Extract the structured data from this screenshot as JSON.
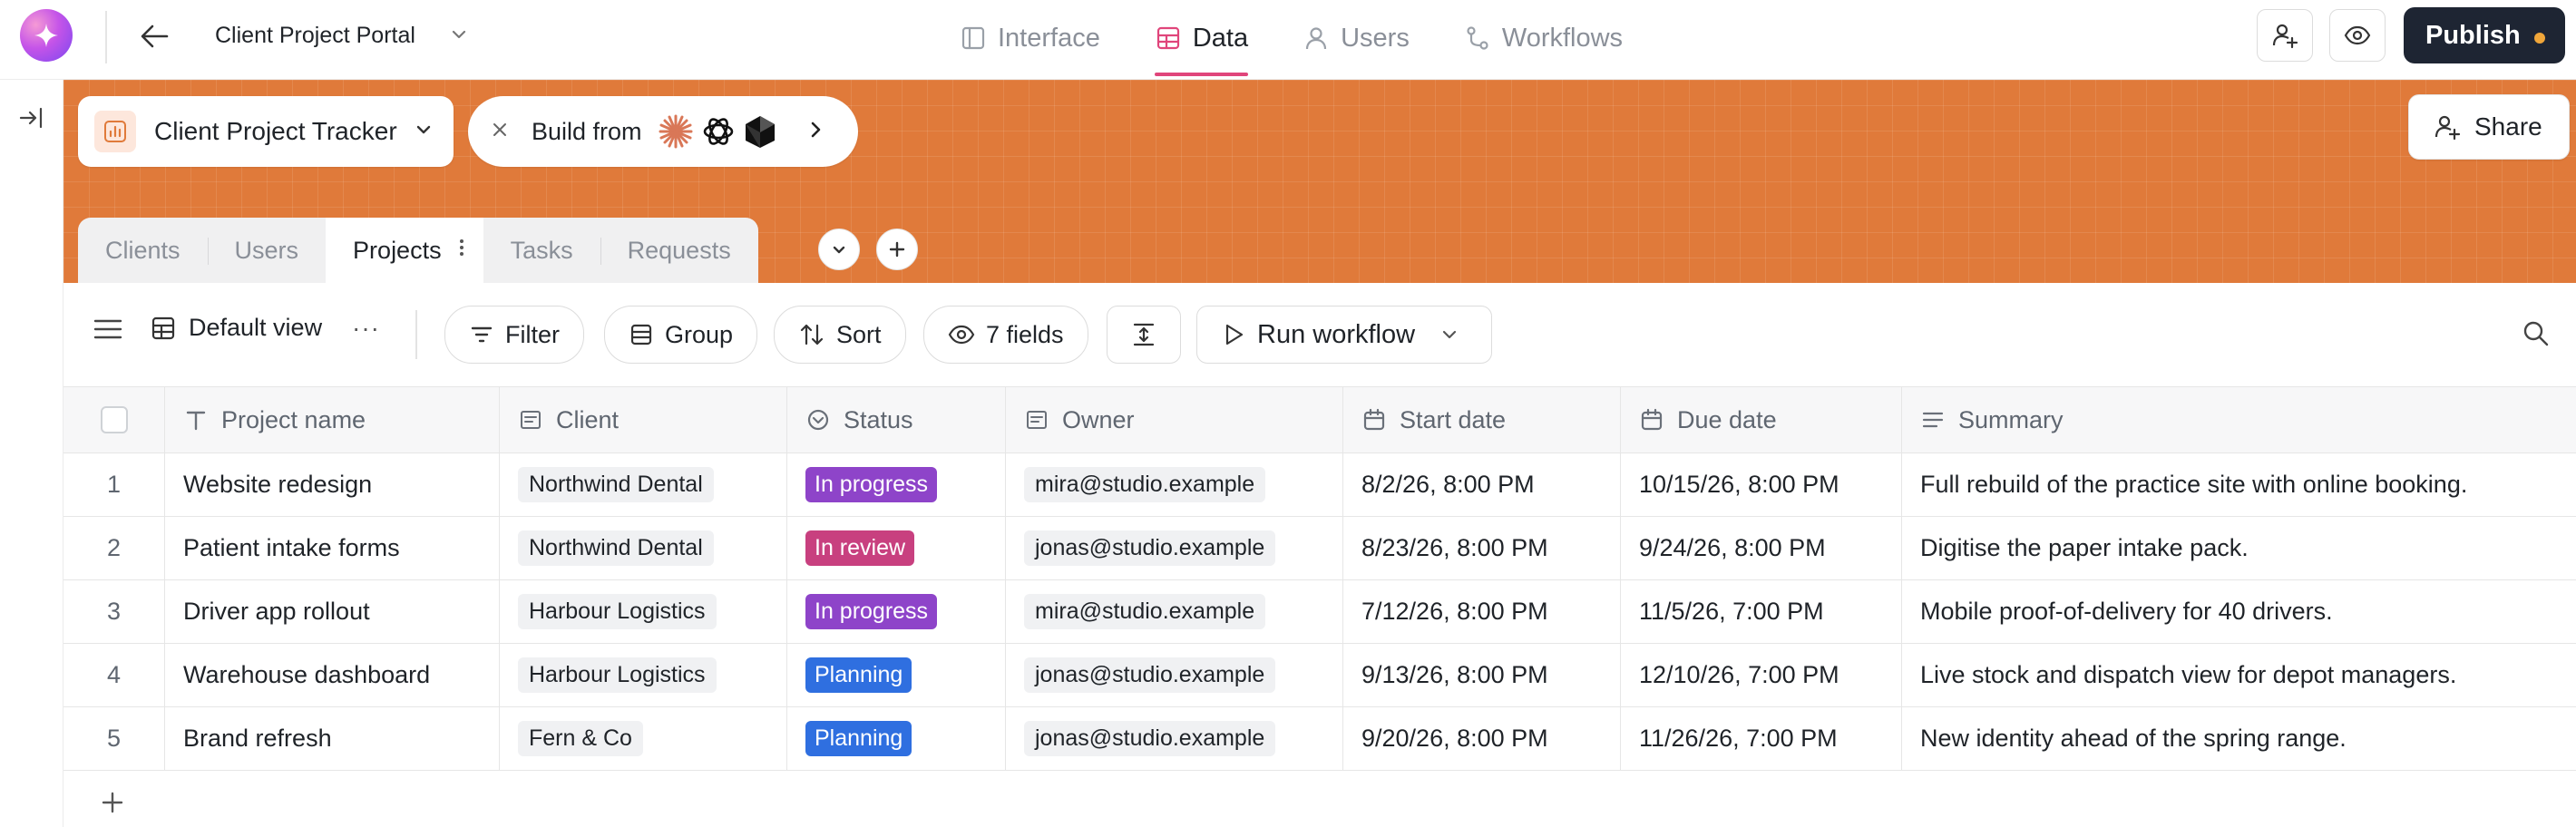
{
  "app": {
    "title": "Client Project Portal"
  },
  "nav": [
    {
      "label": "Interface",
      "icon": "layout-icon",
      "active": false
    },
    {
      "label": "Data",
      "icon": "table-icon",
      "active": true
    },
    {
      "label": "Users",
      "icon": "user-icon",
      "active": false
    },
    {
      "label": "Workflows",
      "icon": "workflow-icon",
      "active": false
    }
  ],
  "actions": {
    "publish_label": "Publish",
    "share_label": "Share"
  },
  "colors": {
    "accent": "#e0457b",
    "banner": "#e07a3a",
    "publish_bg": "#1e2533",
    "status_in_progress": "#8e44c9",
    "status_in_review": "#c8407f",
    "status_planning": "#2f6fe0"
  },
  "header": {
    "tracker_label": "Client Project Tracker",
    "build_label": "Build from"
  },
  "tabs": [
    {
      "label": "Clients",
      "active": false
    },
    {
      "label": "Users",
      "active": false
    },
    {
      "label": "Projects",
      "active": true
    },
    {
      "label": "Tasks",
      "active": false
    },
    {
      "label": "Requests",
      "active": false
    }
  ],
  "toolbar": {
    "view_label": "Default view",
    "view_more": "···",
    "filter_label": "Filter",
    "group_label": "Group",
    "sort_label": "Sort",
    "fields_label": "7 fields",
    "run_label": "Run workflow"
  },
  "columns": [
    {
      "label": "Project name",
      "icon": "text-type-icon"
    },
    {
      "label": "Client",
      "icon": "link-record-icon"
    },
    {
      "label": "Status",
      "icon": "status-icon"
    },
    {
      "label": "Owner",
      "icon": "link-record-icon"
    },
    {
      "label": "Start date",
      "icon": "calendar-icon"
    },
    {
      "label": "Due date",
      "icon": "calendar-icon"
    },
    {
      "label": "Summary",
      "icon": "long-text-icon"
    }
  ],
  "rows": [
    {
      "num": "1",
      "name": "Website redesign",
      "client": "Northwind Dental",
      "status": "In progress",
      "owner": "mira@studio.example",
      "start": "8/2/26, 8:00 PM",
      "due": "10/15/26, 8:00 PM",
      "summary": "Full rebuild of the practice site with online booking."
    },
    {
      "num": "2",
      "name": "Patient intake forms",
      "client": "Northwind Dental",
      "status": "In review",
      "owner": "jonas@studio.example",
      "start": "8/23/26, 8:00 PM",
      "due": "9/24/26, 8:00 PM",
      "summary": "Digitise the paper intake pack."
    },
    {
      "num": "3",
      "name": "Driver app rollout",
      "client": "Harbour Logistics",
      "status": "In progress",
      "owner": "mira@studio.example",
      "start": "7/12/26, 8:00 PM",
      "due": "11/5/26, 7:00 PM",
      "summary": "Mobile proof-of-delivery for 40 drivers."
    },
    {
      "num": "4",
      "name": "Warehouse dashboard",
      "client": "Harbour Logistics",
      "status": "Planning",
      "owner": "jonas@studio.example",
      "start": "9/13/26, 8:00 PM",
      "due": "12/10/26, 7:00 PM",
      "summary": "Live stock and dispatch view for depot managers."
    },
    {
      "num": "5",
      "name": "Brand refresh",
      "client": "Fern & Co",
      "status": "Planning",
      "owner": "jonas@studio.example",
      "start": "9/20/26, 8:00 PM",
      "due": "11/26/26, 7:00 PM",
      "summary": "New identity ahead of the spring range."
    }
  ]
}
